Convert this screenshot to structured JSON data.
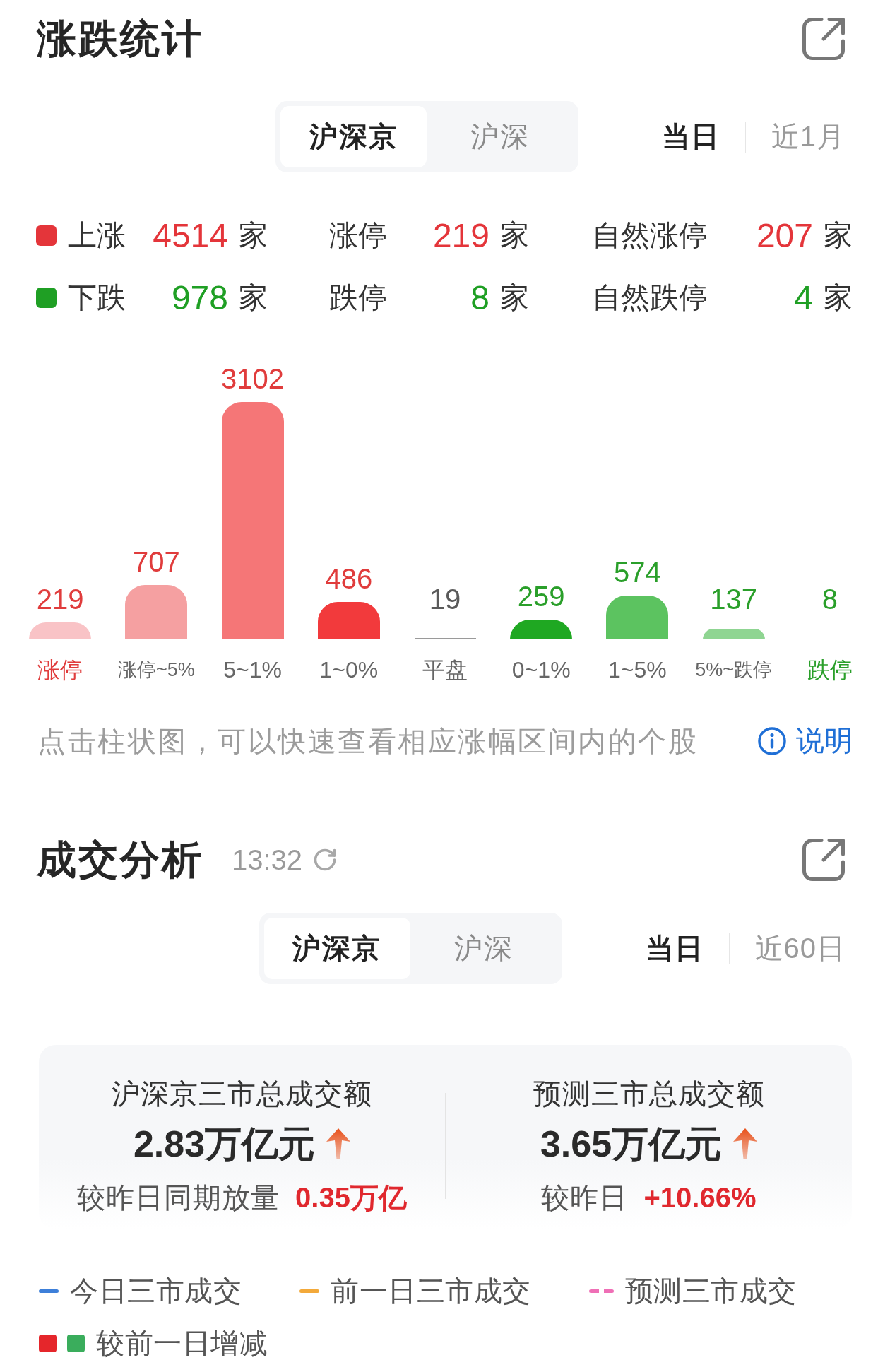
{
  "rise_fall": {
    "title": "涨跌统计",
    "market_tabs": [
      {
        "label": "沪深京",
        "selected": true
      },
      {
        "label": "沪深",
        "selected": false
      }
    ],
    "period_tabs": [
      {
        "label": "当日",
        "selected": true
      },
      {
        "label": "近1月",
        "selected": false
      }
    ],
    "stats": [
      {
        "color": "#e4353a",
        "items": [
          {
            "label": "上涨",
            "value": "4514",
            "unit": "家"
          },
          {
            "label": "涨停",
            "value": "219",
            "unit": "家"
          },
          {
            "label": "自然涨停",
            "value": "207",
            "unit": "家"
          }
        ]
      },
      {
        "color": "#1f9f24",
        "items": [
          {
            "label": "下跌",
            "value": "978",
            "unit": "家"
          },
          {
            "label": "跌停",
            "value": "8",
            "unit": "家"
          },
          {
            "label": "自然跌停",
            "value": "4",
            "unit": "家"
          }
        ]
      }
    ],
    "chart": {
      "chart_data": {
        "type": "bar",
        "categories": [
          "涨停",
          "涨停~5%",
          "5~1%",
          "1~0%",
          "平盘",
          "0~1%",
          "1~5%",
          "5%~跌停",
          "跌停"
        ],
        "values": [
          219,
          707,
          3102,
          486,
          19,
          259,
          574,
          137,
          8
        ],
        "data_labels": true
      },
      "bars": [
        {
          "color": "#f9c3c6",
          "value_label": {
            "color": "#e03c3c"
          },
          "category_label": {
            "color": "#e03c3c"
          }
        },
        {
          "color": "#f5a0a1",
          "value_label": {
            "color": "#e03c3c"
          },
          "category_label": {
            "color": "#666666"
          }
        },
        {
          "color": "#f57677",
          "value_label": {
            "color": "#e03c3c"
          },
          "category_label": {
            "color": "#666666"
          }
        },
        {
          "color": "#f23a3c",
          "value_label": {
            "color": "#e03c3c"
          },
          "category_label": {
            "color": "#666666"
          }
        },
        {
          "color": "#9a9a9a",
          "value_label": {
            "color": "#5a5a5a"
          },
          "category_label": {
            "color": "#666666"
          }
        },
        {
          "color": "#1fa822",
          "value_label": {
            "color": "#2a9f2a"
          },
          "category_label": {
            "color": "#666666"
          }
        },
        {
          "color": "#5cc360",
          "value_label": {
            "color": "#2a9f2a"
          },
          "category_label": {
            "color": "#666666"
          }
        },
        {
          "color": "#8fd592",
          "value_label": {
            "color": "#2a9f2a"
          },
          "category_label": {
            "color": "#666666"
          }
        },
        {
          "color": "#bde8bf",
          "value_label": {
            "color": "#2a9f2a"
          },
          "category_label": {
            "color": "#2a9f2a"
          }
        }
      ]
    },
    "hint": "点击柱状图，可以快速查看相应涨幅区间内的个股",
    "help_link": "说明"
  },
  "turnover": {
    "title": "成交分析",
    "time": "13:32",
    "market_tabs": [
      {
        "label": "沪深京",
        "selected": true
      },
      {
        "label": "沪深",
        "selected": false
      }
    ],
    "period_tabs": [
      {
        "label": "当日",
        "selected": true
      },
      {
        "label": "近60日",
        "selected": false
      }
    ],
    "summary": [
      {
        "title": "沪深京三市总成交额",
        "amount": "2.83万亿元",
        "rising": true,
        "note_label": "较昨日同期放量",
        "note_value": "0.35万亿"
      },
      {
        "title": "预测三市总成交额",
        "amount": "3.65万亿元",
        "rising": true,
        "note_label": "较昨日",
        "note_value": "+10.66%"
      }
    ],
    "legend": [
      {
        "label": "今日三市成交",
        "kind": "line",
        "swatches": [
          {
            "color": "#3d7fd9"
          }
        ]
      },
      {
        "label": "前一日三市成交",
        "kind": "line",
        "swatches": [
          {
            "color": "#f3a93a"
          }
        ]
      },
      {
        "label": "预测三市成交",
        "kind": "dashed",
        "swatches": [
          {
            "color": "#ef6fb6"
          }
        ]
      },
      {
        "label": "较前一日增减",
        "kind": "squares",
        "swatches": [
          {
            "color": "#e5262b"
          },
          {
            "color": "#3aad5c"
          }
        ]
      }
    ]
  }
}
